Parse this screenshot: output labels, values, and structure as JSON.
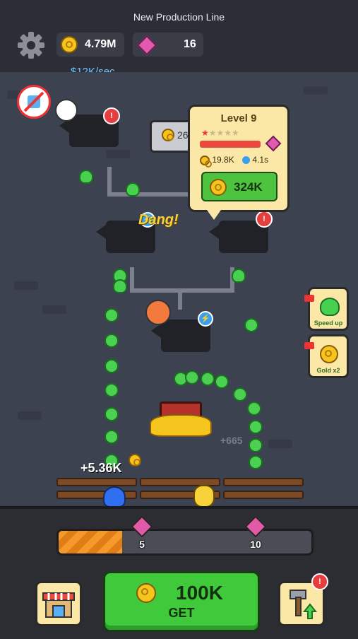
{
  "header": {
    "title": "New Production Line",
    "coins": "4.79M",
    "gems": "16",
    "income_rate": "$12K/sec"
  },
  "tooltip": {
    "level": "Level 9",
    "cost_stat": "19.8K",
    "time_stat": "4.1s",
    "upgrade_price": "324K"
  },
  "field": {
    "forge_partial_value": "26",
    "dang_text": "Dang!",
    "float_income": "+5.36K",
    "float_income_faded": "+665"
  },
  "side_buttons": {
    "speed_label": "Speed up",
    "gold_label": "Gold x2"
  },
  "progress": {
    "fill_fraction": 0.25,
    "milestone_1": "5",
    "milestone_2": "10"
  },
  "bottom": {
    "get_amount": "100K",
    "get_label": "GET"
  },
  "colors": {
    "accent_green": "#3fc93b",
    "coin_gold": "#f6c51d",
    "gem_pink": "#e45ab0",
    "income_blue": "#6fc3ff"
  }
}
